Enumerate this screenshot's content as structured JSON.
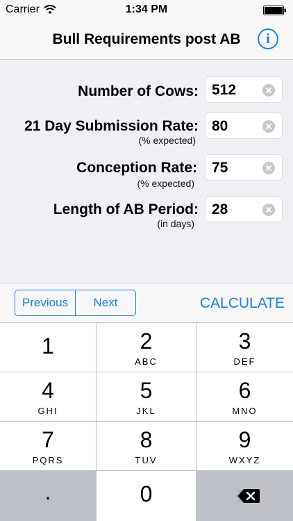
{
  "status": {
    "carrier": "Carrier",
    "time": "1:34 PM"
  },
  "nav": {
    "title": "Bull Requirements post AB",
    "info_label": "i"
  },
  "form": {
    "rows": [
      {
        "label": "Number of Cows:",
        "sublabel": "",
        "value": "512"
      },
      {
        "label": "21 Day Submission Rate:",
        "sublabel": "(% expected)",
        "value": "80"
      },
      {
        "label": "Conception Rate:",
        "sublabel": "(% expected)",
        "value": "75"
      },
      {
        "label": "Length of AB Period:",
        "sublabel": "(in days)",
        "value": "28"
      }
    ]
  },
  "toolbar": {
    "previous_label": "Previous",
    "next_label": "Next",
    "calculate_label": "CALCULATE"
  },
  "keypad": {
    "keys": [
      {
        "digit": "1",
        "letters": ""
      },
      {
        "digit": "2",
        "letters": "ABC"
      },
      {
        "digit": "3",
        "letters": "DEF"
      },
      {
        "digit": "4",
        "letters": "GHI"
      },
      {
        "digit": "5",
        "letters": "JKL"
      },
      {
        "digit": "6",
        "letters": "MNO"
      },
      {
        "digit": "7",
        "letters": "PQRS"
      },
      {
        "digit": "8",
        "letters": "TUV"
      },
      {
        "digit": "9",
        "letters": "WXYZ"
      },
      {
        "digit": ".",
        "letters": ""
      },
      {
        "digit": "0",
        "letters": ""
      }
    ]
  },
  "colors": {
    "accent": "#1a7ff0",
    "form_background": "#efeff4",
    "keypad_background": "#bcc0c6"
  }
}
